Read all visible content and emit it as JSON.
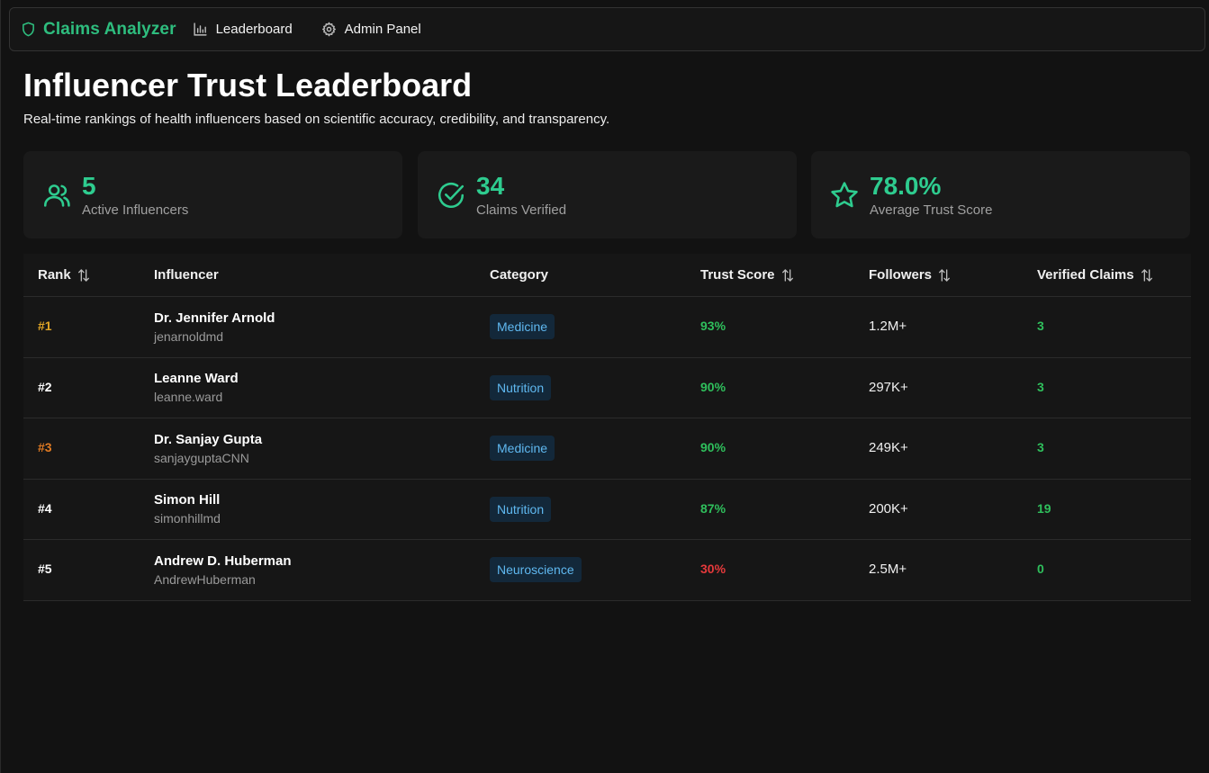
{
  "nav": {
    "brand": "Claims Analyzer",
    "links": [
      {
        "label": "Leaderboard",
        "icon": "bar-chart-icon"
      },
      {
        "label": "Admin Panel",
        "icon": "gear-icon"
      }
    ]
  },
  "header": {
    "title": "Influencer Trust Leaderboard",
    "subtitle": "Real-time rankings of health influencers based on scientific accuracy, credibility, and transparency."
  },
  "stats": [
    {
      "value": "5",
      "label": "Active Influencers",
      "icon": "users-icon"
    },
    {
      "value": "34",
      "label": "Claims Verified",
      "icon": "check-circle-icon"
    },
    {
      "value": "78.0%",
      "label": "Average Trust Score",
      "icon": "star-icon"
    }
  ],
  "table": {
    "headers": {
      "rank": "Rank",
      "influencer": "Influencer",
      "category": "Category",
      "trust": "Trust Score",
      "followers": "Followers",
      "verified": "Verified Claims"
    },
    "rows": [
      {
        "rank": "#1",
        "name": "Dr. Jennifer Arnold",
        "handle": "jenarnoldmd",
        "category": "Medicine",
        "trust": "93%",
        "followers": "1.2M+",
        "verified": "3"
      },
      {
        "rank": "#2",
        "name": "Leanne Ward",
        "handle": "leanne.ward",
        "category": "Nutrition",
        "trust": "90%",
        "followers": "297K+",
        "verified": "3"
      },
      {
        "rank": "#3",
        "name": "Dr. Sanjay Gupta",
        "handle": "sanjaygupta​CNN",
        "category": "Medicine",
        "trust": "90%",
        "followers": "249K+",
        "verified": "3"
      },
      {
        "rank": "#4",
        "name": "Simon Hill",
        "handle": "simonhillmd",
        "category": "Nutrition",
        "trust": "87%",
        "followers": "200K+",
        "verified": "19"
      },
      {
        "rank": "#5",
        "name": "Andrew D. Huberman",
        "handle": "AndrewHuberman",
        "category": "Neuroscience",
        "trust": "30%",
        "followers": "2.5M+",
        "verified": "0"
      }
    ]
  },
  "colors": {
    "accent": "#2ecc8f",
    "rank_gold": "#e0a526",
    "rank_bronze": "#e07a22",
    "rank_default": "#ffffff",
    "trust_high": "#2fbf5c",
    "trust_low": "#e5393b",
    "badge_bg": "#13283a",
    "badge_text": "#5fb8f0"
  }
}
